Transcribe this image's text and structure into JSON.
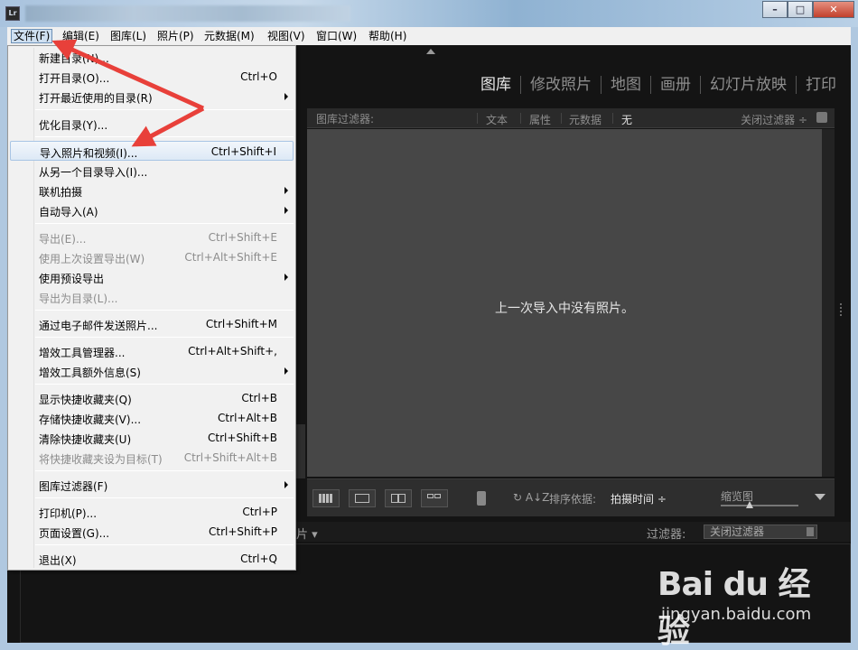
{
  "app": {
    "icon_text": "Lr"
  },
  "window_buttons": {
    "minimize": "–",
    "maximize": "□",
    "close": "✕"
  },
  "menubar": [
    {
      "label": "文件(F)",
      "active": true
    },
    {
      "label": "编辑(E)"
    },
    {
      "label": "图库(L)"
    },
    {
      "label": "照片(P)"
    },
    {
      "label": "元数据(M)"
    },
    {
      "label": "视图(V)"
    },
    {
      "label": "窗口(W)"
    },
    {
      "label": "帮助(H)"
    }
  ],
  "modules": [
    "图库",
    "修改照片",
    "地图",
    "画册",
    "幻灯片放映",
    "打印"
  ],
  "filter_bar": {
    "title": "图库过滤器:",
    "options": [
      "文本",
      "属性",
      "元数据",
      "无"
    ],
    "close_filter": "关闭过滤器 ÷"
  },
  "grid": {
    "empty_message": "上一次导入中没有照片。"
  },
  "toolbar": {
    "sort_label": "排序依据:",
    "sort_value": "拍摄时间 ÷",
    "thumbnail_label": "缩览图"
  },
  "filmstrip": {
    "source_fragment": "片 ▾",
    "filter_label": "过滤器:",
    "filter_value": "关闭过滤器"
  },
  "file_menu": [
    {
      "label": "新建目录(N)...",
      "shortcut": ""
    },
    {
      "label": "打开目录(O)...",
      "shortcut": "Ctrl+O"
    },
    {
      "label": "打开最近使用的目录(R)",
      "shortcut": "",
      "submenu": true
    },
    {
      "sep": true
    },
    {
      "label": "优化目录(Y)...",
      "shortcut": ""
    },
    {
      "sep": true
    },
    {
      "label": "导入照片和视频(I)...",
      "shortcut": "Ctrl+Shift+I",
      "highlight": true
    },
    {
      "label": "从另一个目录导入(I)...",
      "shortcut": ""
    },
    {
      "label": "联机拍摄",
      "shortcut": "",
      "submenu": true
    },
    {
      "label": "自动导入(A)",
      "shortcut": "",
      "submenu": true
    },
    {
      "sep": true
    },
    {
      "label": "导出(E)...",
      "shortcut": "Ctrl+Shift+E",
      "disabled": true
    },
    {
      "label": "使用上次设置导出(W)",
      "shortcut": "Ctrl+Alt+Shift+E",
      "disabled": true
    },
    {
      "label": "使用预设导出",
      "shortcut": "",
      "submenu": true
    },
    {
      "label": "导出为目录(L)...",
      "shortcut": "",
      "disabled": true
    },
    {
      "sep": true
    },
    {
      "label": "通过电子邮件发送照片...",
      "shortcut": "Ctrl+Shift+M"
    },
    {
      "sep": true
    },
    {
      "label": "增效工具管理器...",
      "shortcut": "Ctrl+Alt+Shift+,"
    },
    {
      "label": "增效工具额外信息(S)",
      "shortcut": "",
      "submenu": true
    },
    {
      "sep": true
    },
    {
      "label": "显示快捷收藏夹(Q)",
      "shortcut": "Ctrl+B"
    },
    {
      "label": "存储快捷收藏夹(V)...",
      "shortcut": "Ctrl+Alt+B"
    },
    {
      "label": "清除快捷收藏夹(U)",
      "shortcut": "Ctrl+Shift+B"
    },
    {
      "label": "将快捷收藏夹设为目标(T)",
      "shortcut": "Ctrl+Shift+Alt+B",
      "disabled": true
    },
    {
      "sep": true
    },
    {
      "label": "图库过滤器(F)",
      "shortcut": "",
      "submenu": true
    },
    {
      "sep": true
    },
    {
      "label": "打印机(P)...",
      "shortcut": "Ctrl+P"
    },
    {
      "label": "页面设置(G)...",
      "shortcut": "Ctrl+Shift+P"
    },
    {
      "sep": true
    },
    {
      "label": "退出(X)",
      "shortcut": "Ctrl+Q"
    }
  ],
  "watermark": {
    "logo": "Bai du 经验",
    "url": "jingyan.baidu.com"
  },
  "colors": {
    "arrow": "#e8403a",
    "highlight": "#dde9f6",
    "panel": "#474747"
  }
}
